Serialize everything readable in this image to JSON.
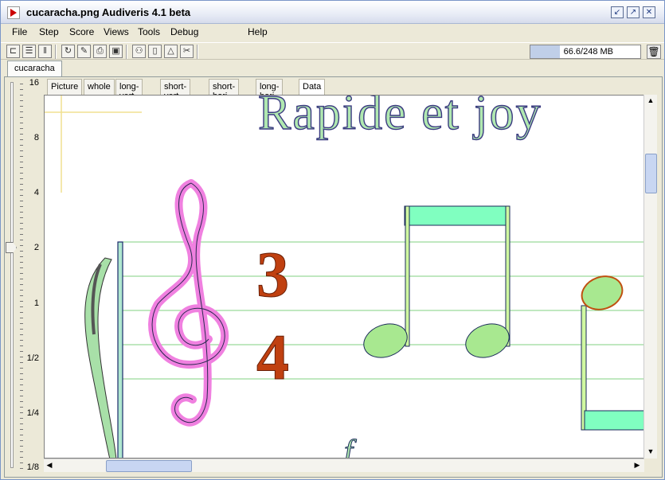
{
  "window": {
    "title": "cucaracha.png Audiveris 4.1 beta"
  },
  "menubar": {
    "items": [
      "File",
      "Step",
      "Score",
      "Views",
      "Tools",
      "Debug",
      "Help"
    ]
  },
  "toolbar": {
    "memory_text": "66.6/248 MB",
    "memory_used_fraction": 0.27
  },
  "tabs": {
    "main": "cucaracha",
    "sub": [
      "Picture",
      "whole",
      "long-vert",
      "short-vert",
      "short-hori",
      "long-hori",
      "Data"
    ]
  },
  "zoom": {
    "labels": [
      "16",
      "8",
      "4",
      "2",
      "1",
      "1/2",
      "1/4",
      "1/8"
    ],
    "current": "2"
  },
  "score_text": {
    "tempo": "Rapide et joy",
    "timesig_top": "3",
    "timesig_bottom": "4",
    "dynamic": "f"
  },
  "colors": {
    "staff_line": "#80d080",
    "clef": "#f080e0",
    "timesig": "#c04010",
    "note_head": "#a8e890",
    "beam": "#80ffc0",
    "text": "#b0e8b0"
  }
}
